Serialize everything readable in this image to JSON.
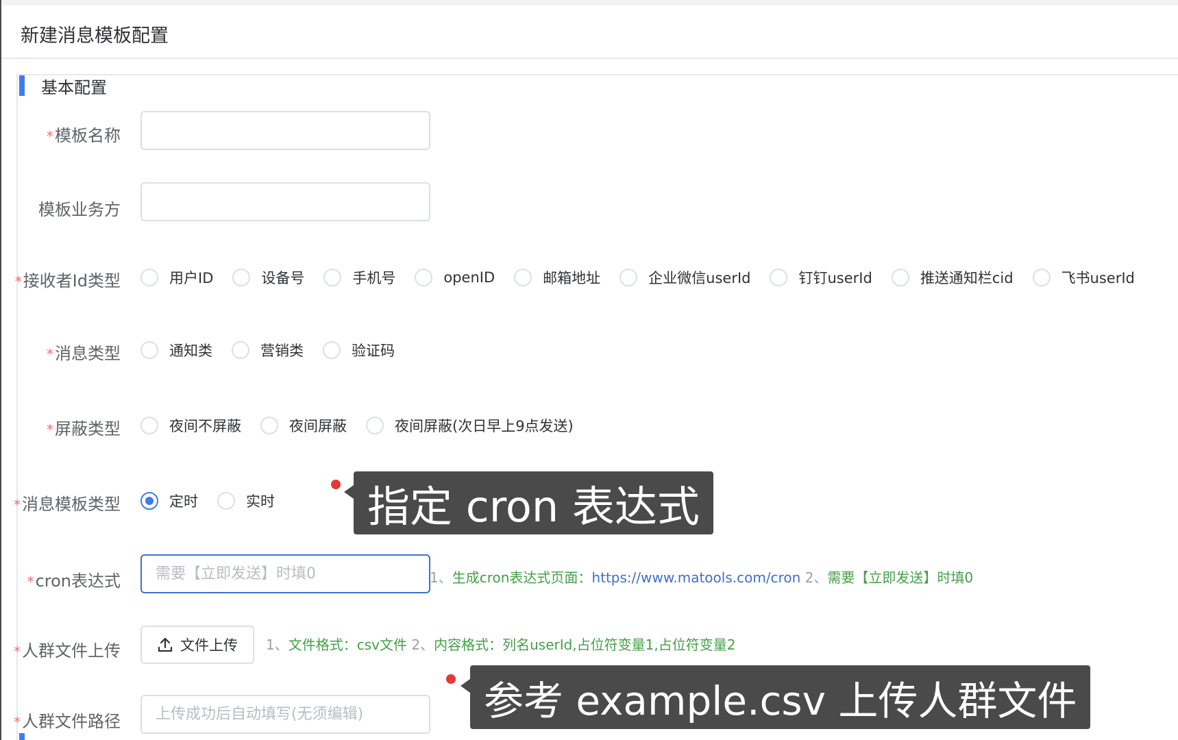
{
  "header": {
    "title": "新建消息模板配置"
  },
  "section": {
    "title": "基本配置"
  },
  "fields": {
    "template_name": {
      "label": "模板名称",
      "required": true,
      "value": ""
    },
    "business": {
      "label": "模板业务方",
      "required": false,
      "value": ""
    },
    "receiver_type": {
      "label": "接收者Id类型",
      "required": true,
      "options": [
        "用户ID",
        "设备号",
        "手机号",
        "openID",
        "邮箱地址",
        "企业微信userId",
        "钉钉userId",
        "推送通知栏cid",
        "飞书userId"
      ]
    },
    "message_type": {
      "label": "消息类型",
      "required": true,
      "options": [
        "通知类",
        "营销类",
        "验证码"
      ]
    },
    "shield_type": {
      "label": "屏蔽类型",
      "required": true,
      "options": [
        "夜间不屏蔽",
        "夜间屏蔽",
        "夜间屏蔽(次日早上9点发送)"
      ]
    },
    "template_kind": {
      "label": "消息模板类型",
      "required": true,
      "options": [
        "定时",
        "实时"
      ],
      "selected": "定时"
    },
    "cron": {
      "label": "cron表达式",
      "required": true,
      "value": "",
      "placeholder": "需要【立即发送】时填0",
      "hint": {
        "n1": "1、",
        "t1": "生成cron表达式页面：",
        "link": "https://www.matools.com/cron",
        "n2": " 2、",
        "t2": "需要【立即发送】时填0"
      }
    },
    "upload": {
      "label": "人群文件上传",
      "required": true,
      "button": "文件上传",
      "hint": {
        "n1": "1、",
        "t1": "文件格式：csv文件",
        "n2": " 2、",
        "t2": "内容格式：列名userId,占位符变量1,占位符变量2"
      }
    },
    "file_path": {
      "label": "人群文件路径",
      "required": true,
      "value": "",
      "placeholder": "上传成功后自动填写(无须编辑)"
    }
  },
  "annotations": {
    "cron_tip": "指定 cron 表达式",
    "csv_tip": "参考 example.csv 上传人群文件"
  },
  "colors": {
    "accent": "#3f7bf0",
    "required": "#f56c6c",
    "hint_green": "#43a047",
    "link": "#3f6fd0",
    "tooltip_bg": "#4a4a4a",
    "marker_red": "#e53935"
  },
  "icons": {
    "upload": "upload-icon"
  }
}
